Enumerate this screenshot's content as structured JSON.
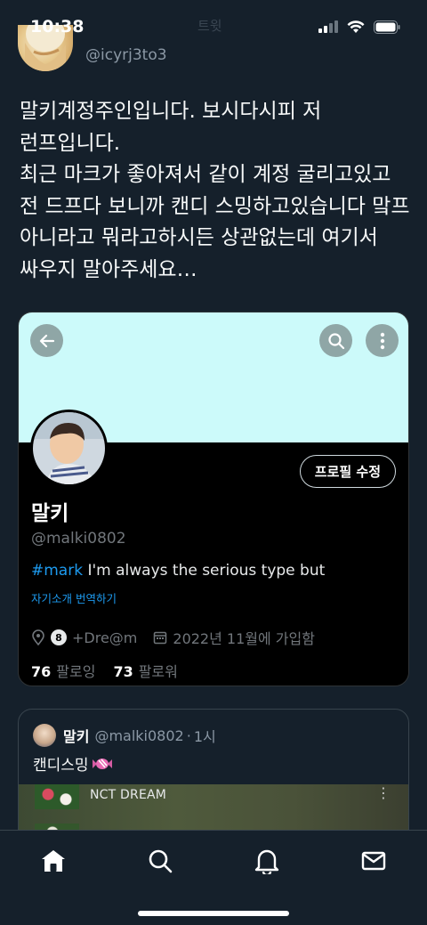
{
  "status_bar": {
    "time": "10:38",
    "center_text": "트윗"
  },
  "author": {
    "handle": "@icyrj3to3"
  },
  "tweet": {
    "text": "말키계정주인입니다. 보시다시피 저 런프입니다.\n최근 마크가 좋아져서 같이 계정 굴리고있고 전 드프다 보니까 캔디 스밍하고있습니다 맠프 아니라고 뭐라고하시든 상관없는데 여기서 싸우지 말아주세요…"
  },
  "profile_card": {
    "banner_color": "#ccfafa",
    "edit_button_label": "프로필 수정",
    "name": "말키",
    "handle": "@malki0802",
    "bio_hashtag": "#mark",
    "bio_rest": " I'm always the serious type but",
    "translate_label": "자기소개 번역하기",
    "location_text": "+Dre@m",
    "location_badge": "8",
    "joined_text": "2022년 11월에 가입함",
    "following_count": "76",
    "following_label": "팔로잉",
    "followers_count": "73",
    "followers_label": "팔로워",
    "icons": [
      "back-arrow-icon",
      "search-icon",
      "more-icon",
      "location-pin-icon",
      "calendar-icon"
    ]
  },
  "quoted_tweet": {
    "name": "말키",
    "handle": "@malki0802",
    "separator": "·",
    "time": "1시",
    "text": "캔디스밍",
    "media_title": "NCT DREAM",
    "media_more": "⋮"
  },
  "bottom_nav": {
    "items": [
      "home-icon",
      "search-icon",
      "notifications-icon",
      "messages-icon"
    ]
  },
  "colors": {
    "background": "#15202b",
    "card_background": "#000000",
    "accent": "#1d9bf0",
    "secondary_text": "#71767b"
  }
}
